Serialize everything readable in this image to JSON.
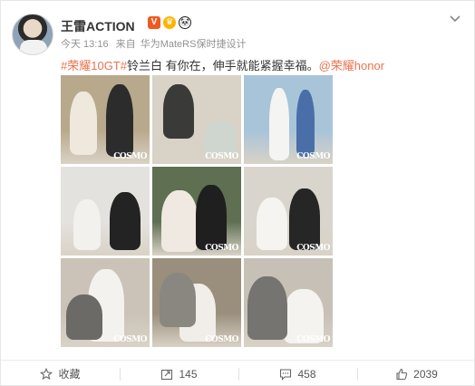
{
  "user": {
    "name": "王雷ACTION",
    "badges": [
      "V",
      "♛",
      "🐼"
    ]
  },
  "post": {
    "time": "今天 13:16",
    "source_prefix": "来自",
    "device": "华为MateRS保时捷设计",
    "hashtag": "#荣耀10GT#",
    "text": "铃兰白 有你在，伸手就能紧握幸福。",
    "mention": "@荣耀honor"
  },
  "photos": [
    {
      "bg": "#b9a98c",
      "a": "#efe8dd",
      "b": "#2c2c2c",
      "mark": "COSMO"
    },
    {
      "bg": "#d8d3c6",
      "a": "#3a3a38",
      "b": "#cfd6cf",
      "mark": "COSMO"
    },
    {
      "bg": "#a7c4d9",
      "a": "#f4f4f2",
      "b": "#4a6fa8",
      "mark": "COSMO"
    },
    {
      "bg": "#e4e2df",
      "a": "#f3f1ee",
      "b": "#232323",
      "mark": ""
    },
    {
      "bg": "#5f6f52",
      "a": "#efe9e1",
      "b": "#1f1f1f",
      "mark": "COSMO"
    },
    {
      "bg": "#d9d5cd",
      "a": "#f6f4f1",
      "b": "#262626",
      "mark": "COSMO"
    },
    {
      "bg": "#cbc3b8",
      "a": "#f4f2ee",
      "b": "#6c6a66",
      "mark": "COSMO"
    },
    {
      "bg": "#9a8f7c",
      "a": "#f1eee9",
      "b": "#8a8780",
      "mark": "COSMO"
    },
    {
      "bg": "#c7c0b6",
      "a": "#f5f3f0",
      "b": "#767470",
      "mark": "COSMO"
    }
  ],
  "actions": {
    "favorite": "收藏",
    "forward": "145",
    "comment": "458",
    "like": "2039"
  },
  "colors": {
    "link": "#eb7350",
    "vip_badge": "#f05a1f"
  }
}
